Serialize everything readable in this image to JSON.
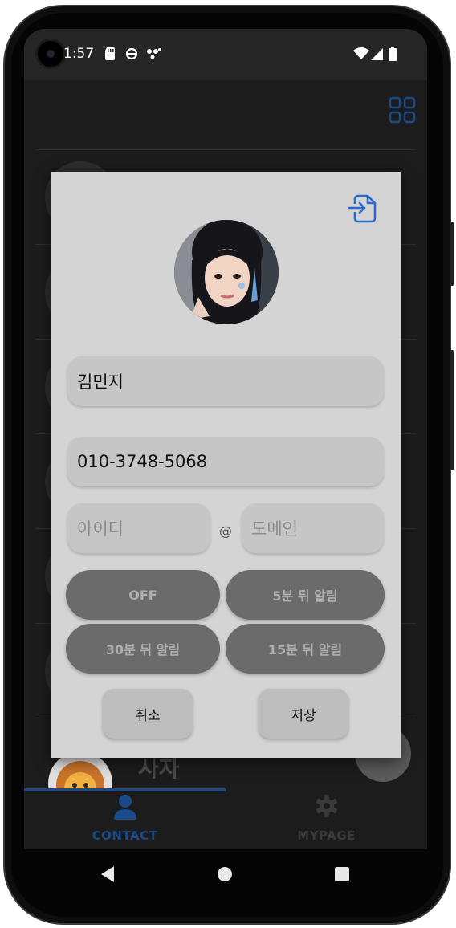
{
  "status_bar": {
    "time": "1:57",
    "icons": [
      "sd-card-icon",
      "sync-icon",
      "dots-icon"
    ],
    "right_icons": [
      "wifi-icon",
      "signal-icon",
      "battery-icon"
    ]
  },
  "app_bar": {
    "icon": "grid-icon",
    "accent": "#1a4a8a"
  },
  "background_list": {
    "visible_item_name": "사자"
  },
  "dialog": {
    "import_icon": "import-file-icon",
    "name_value": "김민지",
    "phone_value": "010-3748-5068",
    "email_id_placeholder": "아이디",
    "email_separator": "@",
    "email_domain_placeholder": "도메인",
    "alarm_options": [
      "OFF",
      "5분 뒤 알림",
      "30분 뒤 알림",
      "15분 뒤 알림"
    ],
    "cancel_label": "취소",
    "save_label": "저장"
  },
  "bottom_nav": {
    "items": [
      {
        "label": "CONTACT",
        "icon": "person-icon",
        "active": true
      },
      {
        "label": "MYPAGE",
        "icon": "gear-icon",
        "active": false
      }
    ]
  },
  "colors": {
    "accent": "#1a4a8a",
    "dialog_bg": "#d4d4d4",
    "pill_bg": "#6b6b6b"
  }
}
